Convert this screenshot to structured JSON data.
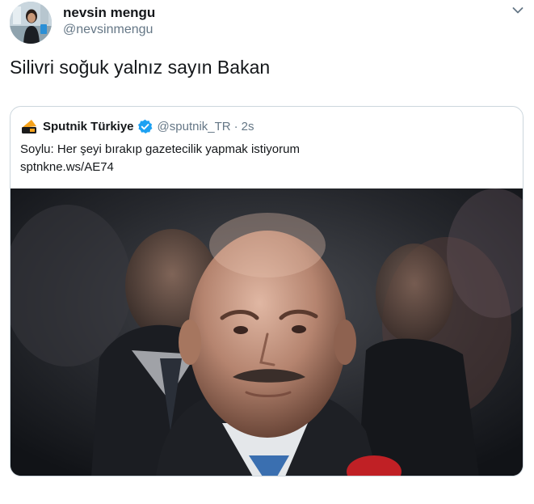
{
  "author": {
    "name": "nevsin mengu",
    "handle": "@nevsinmengu"
  },
  "tweet": {
    "text": "Silivri soğuk yalnız sayın Bakan"
  },
  "quoted": {
    "name": "Sputnik Türkiye",
    "handle": "@sputnik_TR",
    "separator": "·",
    "time": "2s",
    "text": "Soylu: Her şeyi bırakıp gazetecilik yapmak istiyorum",
    "link": "sptnkne.ws/AE74"
  },
  "icons": {
    "avatar": "profile-photo",
    "menu": "chevron-down-icon",
    "publisher_logo": "sputnik-logo",
    "verified": "verified-badge-icon"
  },
  "colors": {
    "text_primary": "#14171a",
    "text_secondary": "#657786",
    "border": "#ccd6dd",
    "verified": "#1da1f2",
    "sputnik_orange": "#f6a31c"
  }
}
